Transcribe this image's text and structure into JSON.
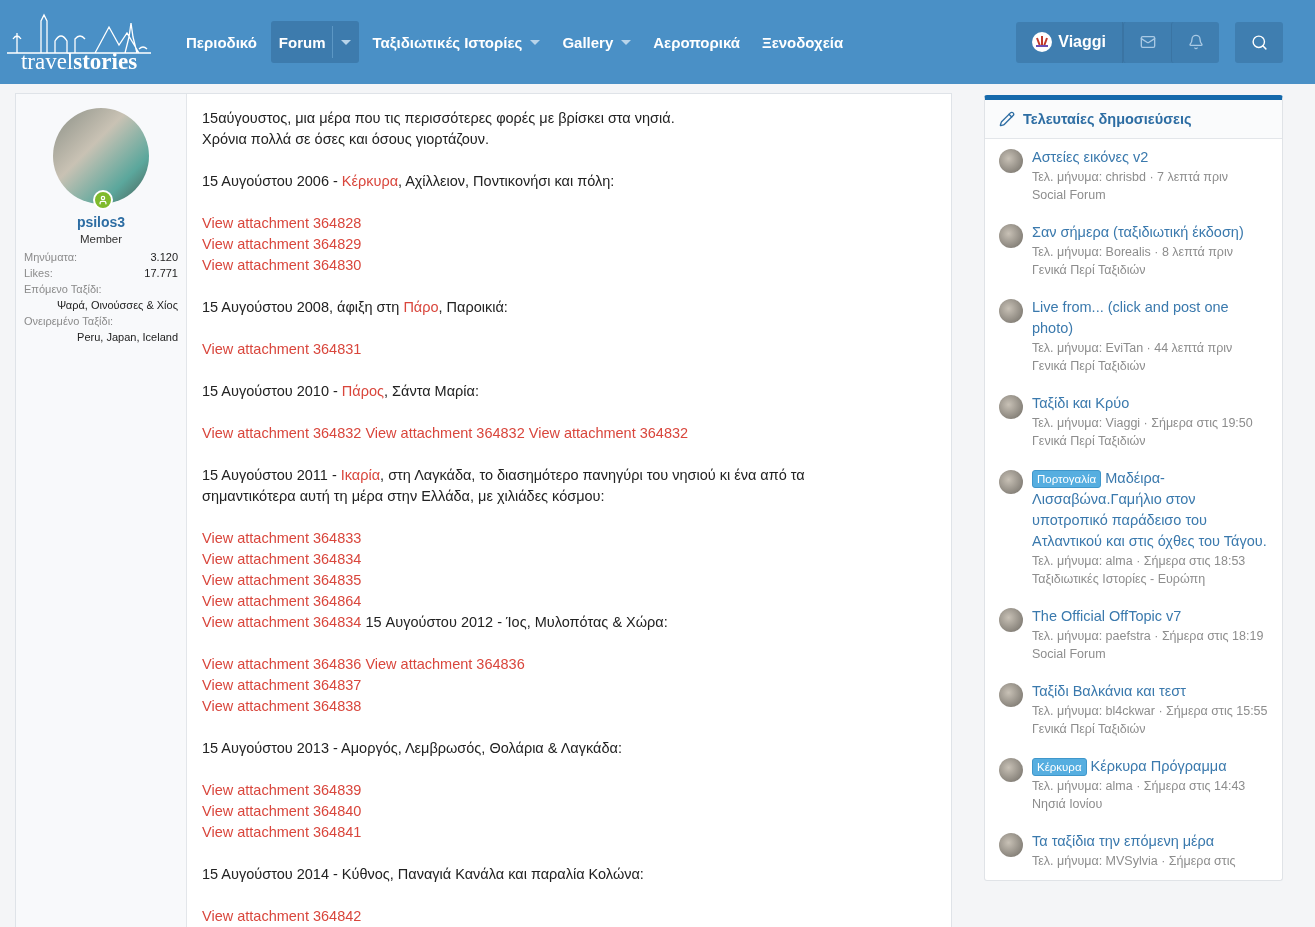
{
  "header": {
    "logo": "travel**stories**",
    "nav": [
      {
        "label": "Περιοδικό",
        "selected": false,
        "dropdown": false
      },
      {
        "label": "Forum",
        "selected": true,
        "dropdown": true
      },
      {
        "label": "Ταξιδιωτικές Ιστορίες",
        "selected": false,
        "dropdown": true
      },
      {
        "label": "Gallery",
        "selected": false,
        "dropdown": true
      },
      {
        "label": "Αεροπορικά",
        "selected": false,
        "dropdown": false
      },
      {
        "label": "Ξενοδοχεία",
        "selected": false,
        "dropdown": false
      }
    ],
    "user": "Viaggi"
  },
  "author": {
    "name": "psilos3",
    "online": true,
    "title": "Member",
    "stats": [
      {
        "kind": "inline",
        "label": "Μηνύματα:",
        "value": "3.120"
      },
      {
        "kind": "inline",
        "label": "Likes:",
        "value": "17.771"
      },
      {
        "kind": "stacked",
        "label": "Επόμενο Ταξίδι:",
        "value": "Ψαρά, Οινούσσες & Χίος"
      },
      {
        "kind": "stacked",
        "label": "Ονειρεμένο Ταξίδι:",
        "value": "Peru, Japan, Iceland"
      }
    ]
  },
  "post": [
    [
      [
        {
          "kind": "text",
          "text": "15αύγουστος, μια μέρα που τις περισσότερες φορές με βρίσκει στα νησιά."
        }
      ],
      [
        {
          "kind": "text",
          "text": "Χρόνια πολλά σε όσες και όσους γιορτάζουν."
        }
      ]
    ],
    [
      [
        {
          "kind": "text",
          "text": "15 Αυγούστου 2006 - "
        },
        {
          "kind": "link",
          "text": "Κέρκυρα"
        },
        {
          "kind": "text",
          "text": ", Αχίλλειον, Ποντικονήσι και πόλη:"
        }
      ]
    ],
    [
      [
        {
          "kind": "link",
          "text": "View attachment 364828"
        }
      ],
      [
        {
          "kind": "link",
          "text": "View attachment 364829"
        }
      ],
      [
        {
          "kind": "link",
          "text": "View attachment 364830"
        }
      ]
    ],
    [
      [
        {
          "kind": "text",
          "text": "15 Αυγούστου 2008, άφιξη στη "
        },
        {
          "kind": "link",
          "text": "Πάρο"
        },
        {
          "kind": "text",
          "text": ", Παροικιά:"
        }
      ]
    ],
    [
      [
        {
          "kind": "link",
          "text": "View attachment 364831"
        }
      ]
    ],
    [
      [
        {
          "kind": "text",
          "text": "15 Αυγούστου 2010 - "
        },
        {
          "kind": "link",
          "text": "Πάρος"
        },
        {
          "kind": "text",
          "text": ", Σάντα Μαρία:"
        }
      ]
    ],
    [
      [
        {
          "kind": "link",
          "text": "View attachment 364832"
        },
        {
          "kind": "link",
          "text": "View attachment 364832"
        },
        {
          "kind": "link",
          "text": "View attachment 364832"
        }
      ]
    ],
    [
      [
        {
          "kind": "text",
          "text": "15 Αυγούστου 2011 - "
        },
        {
          "kind": "link",
          "text": "Ικαρία"
        },
        {
          "kind": "text",
          "text": ", στη Λαγκάδα, το διασημότερο πανηγύρι του νησιού κι ένα από τα σημαντικότερα αυτή τη μέρα στην Ελλάδα, με χιλιάδες κόσμου:"
        }
      ]
    ],
    [
      [
        {
          "kind": "link",
          "text": "View attachment 364833"
        }
      ],
      [
        {
          "kind": "link",
          "text": "View attachment 364834"
        }
      ],
      [
        {
          "kind": "link",
          "text": "View attachment 364835"
        }
      ],
      [
        {
          "kind": "link",
          "text": "View attachment 364864"
        }
      ],
      [
        {
          "kind": "link",
          "text": "View attachment 364834"
        },
        {
          "kind": "text",
          "text": " 15 Αυγούστου 2012 - Ίος, Μυλοπότας & Χώρα:"
        }
      ]
    ],
    [
      [
        {
          "kind": "link",
          "text": "View attachment 364836"
        },
        {
          "kind": "link",
          "text": "View attachment 364836"
        }
      ],
      [
        {
          "kind": "link",
          "text": "View attachment 364837"
        }
      ],
      [
        {
          "kind": "link",
          "text": "View attachment 364838"
        }
      ]
    ],
    [
      [
        {
          "kind": "text",
          "text": "15 Αυγούστου 2013 - Αμοργός, Λεμβρωσός, Θολάρια & Λαγκάδα:"
        }
      ]
    ],
    [
      [
        {
          "kind": "link",
          "text": "View attachment 364839"
        }
      ],
      [
        {
          "kind": "link",
          "text": "View attachment 364840"
        }
      ],
      [
        {
          "kind": "link",
          "text": "View attachment 364841"
        }
      ]
    ],
    [
      [
        {
          "kind": "text",
          "text": "15 Αυγούστου 2014 - Κύθνος, Παναγιά Κανάλα και παραλία Κολώνα:"
        }
      ]
    ],
    [
      [
        {
          "kind": "link",
          "text": "View attachment 364842"
        }
      ]
    ]
  ],
  "sidebar": {
    "title": "Τελευταίες δημοσιεύσεις",
    "items": [
      {
        "title": "Αστείες εικόνες v2",
        "meta": "Τελ. μήνυμα: chrisbd · 7 λεπτά πριν",
        "forum": "Social Forum"
      },
      {
        "title": "Σαν σήμερα (ταξιδιωτική έκδοση)",
        "meta": "Τελ. μήνυμα: Borealis · 8 λεπτά πριν",
        "forum": "Γενικά Περί Ταξιδιών"
      },
      {
        "title": "Live from... (click and post one photo)",
        "meta": "Τελ. μήνυμα: EviTan · 44 λεπτά πριν",
        "forum": "Γενικά Περί Ταξιδιών"
      },
      {
        "title": "Ταξίδι και Κρύο",
        "meta": "Τελ. μήνυμα: Viaggi · Σήμερα στις 19:50",
        "forum": "Γενικά Περί Ταξιδιών"
      },
      {
        "prefix": "Πορτογαλία",
        "title": "Μαδέιρα-Λισσαβώνα.Γαμήλιο στον υποτροπικό παράδεισο του Ατλαντικού και στις όχθες του Τάγου.",
        "meta": "Τελ. μήνυμα: alma · Σήμερα στις 18:53",
        "forum": "Ταξιδιωτικές Ιστορίες - Ευρώπη"
      },
      {
        "title": "The Official OffTopic v7",
        "meta": "Τελ. μήνυμα: paefstra · Σήμερα στις 18:19",
        "forum": "Social Forum"
      },
      {
        "title": "Ταξίδι Βαλκάνια και τεστ",
        "meta": "Τελ. μήνυμα: bl4ckwar · Σήμερα στις 15:55",
        "forum": "Γενικά Περί Ταξιδιών"
      },
      {
        "prefix": "Κέρκυρα",
        "title": "Κέρκυρα Πρόγραμμα",
        "meta": "Τελ. μήνυμα: alma · Σήμερα στις 14:43",
        "forum": "Νησιά Ιονίου"
      },
      {
        "title": "Τα ταξίδια την επόμενη μέρα",
        "meta": "Τελ. μήνυμα: MVSylvia · Σήμερα στις"
      }
    ]
  }
}
